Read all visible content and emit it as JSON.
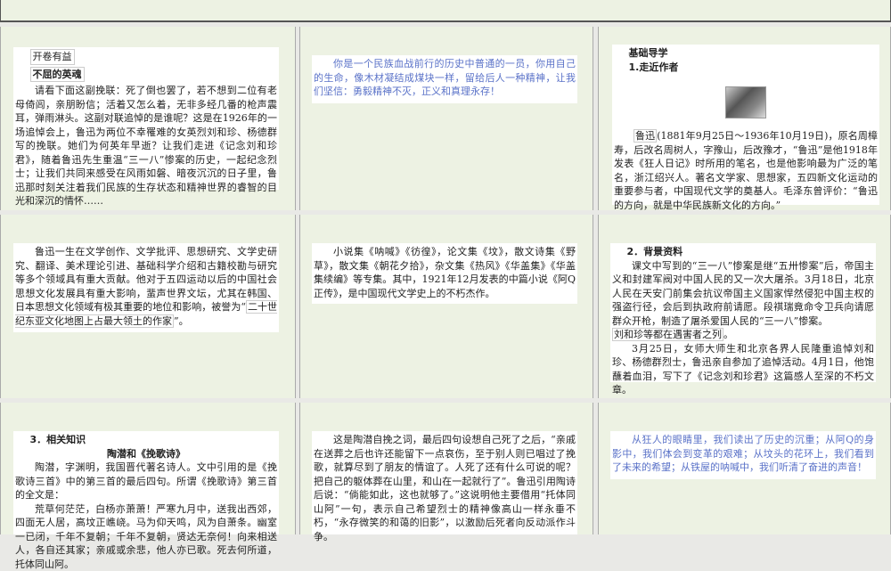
{
  "panels": [
    {
      "tag": "开卷有益",
      "heading": "不屈的英魂",
      "paragraphs": [
        "请看下面这副挽联：死了倒也罢了，若不想到二位有老母倚闾，亲朋盼信；活着又怎么着，无非多经几番的枪声震耳，弹雨淋头。这副对联追悼的是谁呢？这是在1926年的一场追悼会上，鲁迅为两位不幸罹难的女英烈刘和珍、杨德群写的挽联。她们为何英年早逝？让我们走进《记念刘和珍君》，随着鲁迅先生重温“三一八”惨案的历史，一起纪念烈士；让我们共同来感受在风雨如磐、暗夜沉沉的日子里，鲁迅那时刻关注着我们民族的生存状态和精神世界的睿智的目光和深沉的情怀……"
      ]
    },
    {
      "paragraphs": [
        "你是一个民族血战前行的历史中普通的一员，你用自己的生命，像木材凝结成煤块一样，留给后人一种精神，让我们坚信：勇毅精神不灭，正义和真理永存！"
      ]
    },
    {
      "heading": "基础导学",
      "subheading": "1.走近作者",
      "name": "鲁迅",
      "paragraphs": [
        "(1881年9月25日～1936年10月19日)，原名周樟寿，后改名周树人，字豫山，后改豫才，“鲁迅”是他1918年发表《狂人日记》时所用的笔名，也是他影响最为广泛的笔名，浙江绍兴人。著名文学家、思想家，五四新文化运动的重要参与者，中国现代文学的奠基人。毛泽东曾评价：“鲁迅的方向，就是中华民族新文化的方向。”"
      ]
    },
    {
      "paragraphs": [
        "鲁迅一生在文学创作、文学批评、思想研究、文学史研究、翻译、美术理论引进、基础科学介绍和古籍校勘与研究等多个领域具有重大贡献。他对于五四运动以后的中国社会思想文化发展具有重大影响，蜚声世界文坛，尤其在韩国、日本思想文化领域有极其重要的地位和影响，被誉为"
      ],
      "quote": "二十世纪东亚文化地图上占最大领土的作家"
    },
    {
      "paragraphs": [
        "小说集《呐喊》《彷徨》，论文集《坟》，散文诗集《野草》，散文集《朝花夕拾》，杂文集《热风》《华盖集》《华盖集续编》等专集。其中，1921年12月发表的中篇小说《阿Q正传》，是中国现代文学史上的不朽杰作。"
      ]
    },
    {
      "heading": "2．背景资料",
      "paragraphs": [
        "课文中写到的“三一八”惨案是继“五卅惨案”后，帝国主义和封建军阀对中国人民的又一次大屠杀。3月18日，北京人民在天安门前集会抗议帝国主义国家悍然侵犯中国主权的强盗行径，会后到执政府前请愿。段祺瑞竟命令卫兵向请愿群众开枪，制造了屠杀爱国人民的“三一八”惨案。",
        "3月25日，女师大师生和北京各界人民隆重追悼刘和珍、杨德群烈士，鲁迅亲自参加了追悼活动。4月1日，他饱蘸着血泪，写下了《记念刘和珍君》这篇感人至深的不朽文章。"
      ],
      "boxed": "刘和珍等都在遇害者之列"
    },
    {
      "heading": "3．相关知识",
      "subheading": "陶潜和《挽歌诗》",
      "paragraphs": [
        "陶潜，字渊明，我国晋代著名诗人。文中引用的是《挽歌诗三首》中的第三首的最后四句。所谓《挽歌诗》第三首的全文是：",
        "荒草何茫茫，白杨亦萧萧！严寒九月中，送我出西郊，四面无人居，高坟正嶕峣。马为仰天鸣，风为自萧条。幽室一已闭，千年不复朝；千年不复朝，贤达无奈何！向来相送人，各自还其家；亲戚或余悲，他人亦已歌。死去何所道，托体同山阿。"
      ]
    },
    {
      "paragraphs": [
        "这是陶潜自挽之词，最后四句设想自己死了之后，“亲戚在送葬之后也许还能留下一点哀伤，至于别人则已唱过了挽歌，就算尽到了朋友的情谊了。人死了还有什么可说的呢？把自己的躯体葬在山里，和山在一起就行了”。鲁迅引用陶诗后说：“倘能如此，这也就够了。”这说明他主要借用“托体同山阿”一句，表示自己希望烈士的精神像高山一样永垂不朽，“永存微笑的和蔼的旧影”，以激励后死者向反动派作斗争。"
      ]
    },
    {
      "paragraphs": [
        "从狂人的眼睛里，我们读出了历史的沉重；从阿Q的身影中，我们体会到变革的艰难；从坟头的花环上，我们看到了未来的希望；从铁屋的呐喊中，我们听清了奋进的声音！"
      ]
    }
  ],
  "colors": {
    "panel_bg": "#edf2e3",
    "accent_text": "#5a72c8"
  }
}
